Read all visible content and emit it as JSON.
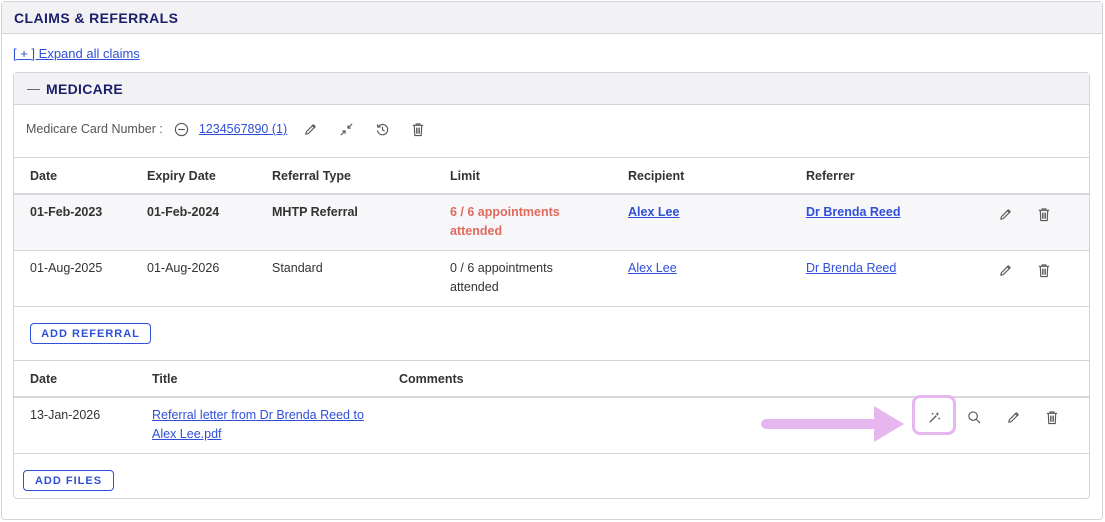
{
  "section": {
    "title": "CLAIMS & REFERRALS",
    "expand_link": "[ + ] Expand all claims"
  },
  "medicare": {
    "collapse_symbol": "—",
    "title": "MEDICARE",
    "card_label": "Medicare Card Number :",
    "card_number": "1234567890 (1)"
  },
  "referrals": {
    "headers": {
      "date": "Date",
      "expiry": "Expiry Date",
      "type": "Referral Type",
      "limit": "Limit",
      "recipient": "Recipient",
      "referrer": "Referrer"
    },
    "rows": [
      {
        "date": "01-Feb-2023",
        "expiry": "01-Feb-2024",
        "type": "MHTP Referral",
        "limit_line1": "6 / 6 appointments",
        "limit_line2": "attended",
        "recipient": "Alex Lee",
        "referrer": "Dr Brenda Reed"
      },
      {
        "date": "01-Aug-2025",
        "expiry": "01-Aug-2026",
        "type": "Standard",
        "limit_line1": "0 / 6 appointments",
        "limit_line2": "attended",
        "recipient": "Alex Lee",
        "referrer": "Dr Brenda Reed"
      }
    ],
    "add_button": "ADD REFERRAL"
  },
  "files": {
    "headers": {
      "date": "Date",
      "title": "Title",
      "comments": "Comments"
    },
    "rows": [
      {
        "date": "13-Jan-2026",
        "title_line1": "Referral letter from Dr Brenda Reed to",
        "title_line2": "Alex Lee.pdf",
        "comments": ""
      }
    ],
    "add_button": "ADD FILES"
  },
  "colors": {
    "accent": "#2f4fd8",
    "heading": "#1b1f6b",
    "alert": "#e06a5e",
    "highlight": "#e6b7ef"
  },
  "icons": [
    "minus-circle-icon",
    "pencil-icon",
    "collapse-arrows-icon",
    "history-icon",
    "trash-icon",
    "magic-wand-icon",
    "search-icon"
  ]
}
